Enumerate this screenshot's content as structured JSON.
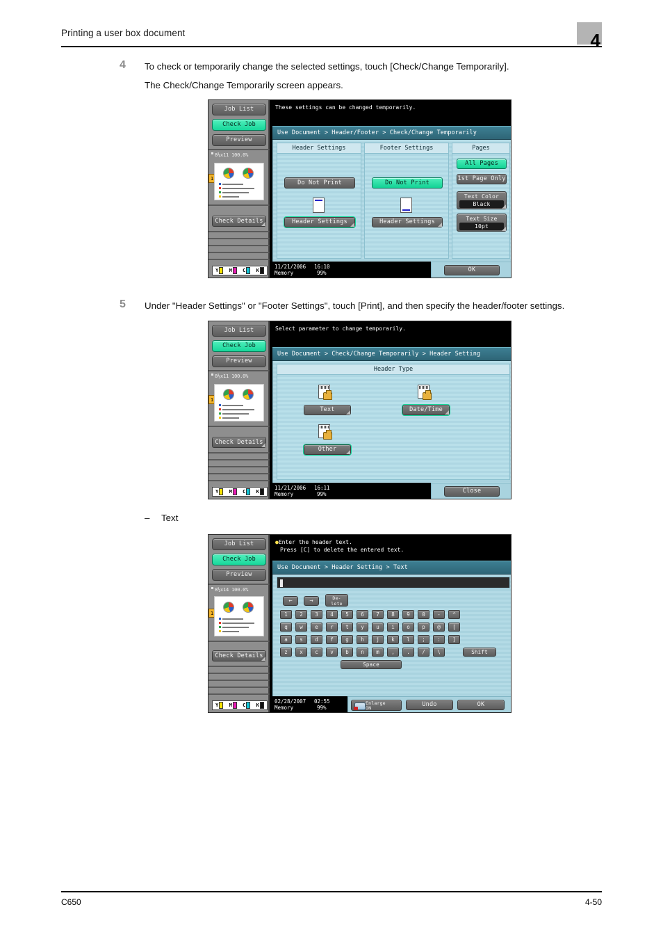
{
  "page": {
    "header_title": "Printing a user box document",
    "chapter": "4",
    "footer_left": "C650",
    "footer_right": "4-50"
  },
  "steps": [
    {
      "num": "4",
      "line1": "To check or temporarily change the selected settings, touch [Check/Change Temporarily].",
      "line2": "The Check/Change Temporarily screen appears."
    },
    {
      "num": "5",
      "line1": "Under \"Header Settings\" or \"Footer Settings\", touch [Print], and then specify the header/footer settings."
    }
  ],
  "sub_item": {
    "dash": "–",
    "label": "Text"
  },
  "panel1": {
    "message": "These settings can be changed temporarily.",
    "breadcrumb": "Use Document > Header/Footer > Check/Change Temporarily",
    "sidebar": {
      "job_list": "Job List",
      "check_job": "Check Job",
      "preview": "Preview",
      "paper_info": "8½x11    100.0%",
      "page_mark": "1",
      "check_details": "Check Details",
      "toner": [
        "Y",
        "M",
        "C",
        "K"
      ]
    },
    "columns": {
      "header": {
        "title": "Header Settings",
        "button": "Do Not Print",
        "settings_button": "Header Settings"
      },
      "footer": {
        "title": "Footer Settings",
        "button": "Do Not Print",
        "settings_button": "Header Settings"
      },
      "pages": {
        "title": "Pages",
        "all_pages": "All Pages",
        "first_page_only": "1st Page Only",
        "text_color_label": "Text Color",
        "text_color_value": "Black",
        "text_size_label": "Text Size",
        "text_size_value": "10pt"
      }
    },
    "status": {
      "date": "11/21/2006",
      "time": "16:10",
      "memory_label": "Memory",
      "memory_value": "99%"
    },
    "ok_button": "OK"
  },
  "panel2": {
    "message": "Select parameter to change temporarily.",
    "breadcrumb": "Use Document > Check/Change Temporarily > Header Setting",
    "sidebar": {
      "job_list": "Job List",
      "check_job": "Check Job",
      "preview": "Preview",
      "paper_info": "8½x11    100.0%",
      "page_mark": "1",
      "check_details": "Check Details",
      "toner": [
        "Y",
        "M",
        "C",
        "K"
      ]
    },
    "section_title": "Header Type",
    "types": [
      {
        "label": "Text",
        "selected": false
      },
      {
        "label": "Date/Time",
        "selected": true
      },
      {
        "label": "Other",
        "selected": true
      }
    ],
    "status": {
      "date": "11/21/2006",
      "time": "16:11",
      "memory_label": "Memory",
      "memory_value": "99%"
    },
    "close_button": "Close"
  },
  "panel3": {
    "message_line1": "Enter the header text.",
    "message_line2": "Press [C] to delete the entered text.",
    "breadcrumb": "Use Document > Header Setting > Text",
    "sidebar": {
      "job_list": "Job List",
      "check_job": "Check Job",
      "preview": "Preview",
      "paper_info": "8½x14    100.0%",
      "page_mark": "1",
      "check_details": "Check Details",
      "toner": [
        "Y",
        "M",
        "C",
        "K"
      ]
    },
    "input_value": "",
    "nav_keys": {
      "left": "←",
      "right": "→",
      "delete_l1": "De-",
      "delete_l2": "lete"
    },
    "keyboard": {
      "row1": [
        "1",
        "2",
        "3",
        "4",
        "5",
        "6",
        "7",
        "8",
        "9",
        "0",
        "-",
        "^"
      ],
      "row2": [
        "q",
        "w",
        "e",
        "r",
        "t",
        "y",
        "u",
        "i",
        "o",
        "p",
        "@",
        "["
      ],
      "row3": [
        "a",
        "s",
        "d",
        "f",
        "g",
        "h",
        "j",
        "k",
        "l",
        ";",
        ":",
        "]"
      ],
      "row4": [
        "z",
        "x",
        "c",
        "v",
        "b",
        "n",
        "m",
        ",",
        ".",
        "/",
        "\\"
      ],
      "shift": "Shift",
      "space": "Space"
    },
    "enlarge_l1": "Enlarge",
    "enlarge_l2": "ON",
    "undo_button": "Undo",
    "ok_button": "OK",
    "status": {
      "date": "02/28/2007",
      "time": "02:55",
      "memory_label": "Memory",
      "memory_value": "99%"
    }
  },
  "colors": {
    "accent_green": "#16d79b",
    "lcd_blue": "#aed7e3",
    "crumb_teal": "#337084",
    "chapter_gray": "#b4b4b4"
  }
}
